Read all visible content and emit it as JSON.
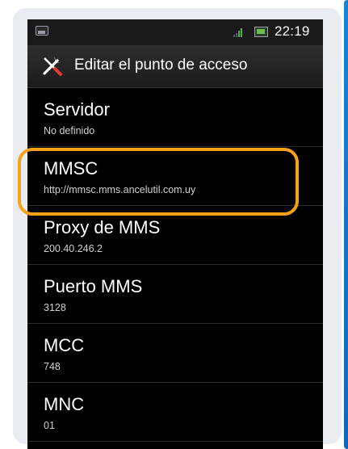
{
  "status_bar": {
    "time": "22:19",
    "icons": [
      "photo-notification-icon",
      "signal-icon",
      "battery-icon"
    ],
    "signal_color": "#4caf50"
  },
  "header": {
    "icon": "wrench-screwdriver-icon",
    "title": "Editar el punto de acceso"
  },
  "items": [
    {
      "label": "Servidor",
      "value": "No definido"
    },
    {
      "label": "MMSC",
      "value": "http://mmsc.mms.ancelutil.com.uy"
    },
    {
      "label": "Proxy de MMS",
      "value": "200.40.246.2"
    },
    {
      "label": "Puerto MMS",
      "value": "3128"
    },
    {
      "label": "MCC",
      "value": "748"
    },
    {
      "label": "MNC",
      "value": "01"
    }
  ],
  "highlight_color": "#f6a31a",
  "accent_edge_color": "#1b82d3"
}
